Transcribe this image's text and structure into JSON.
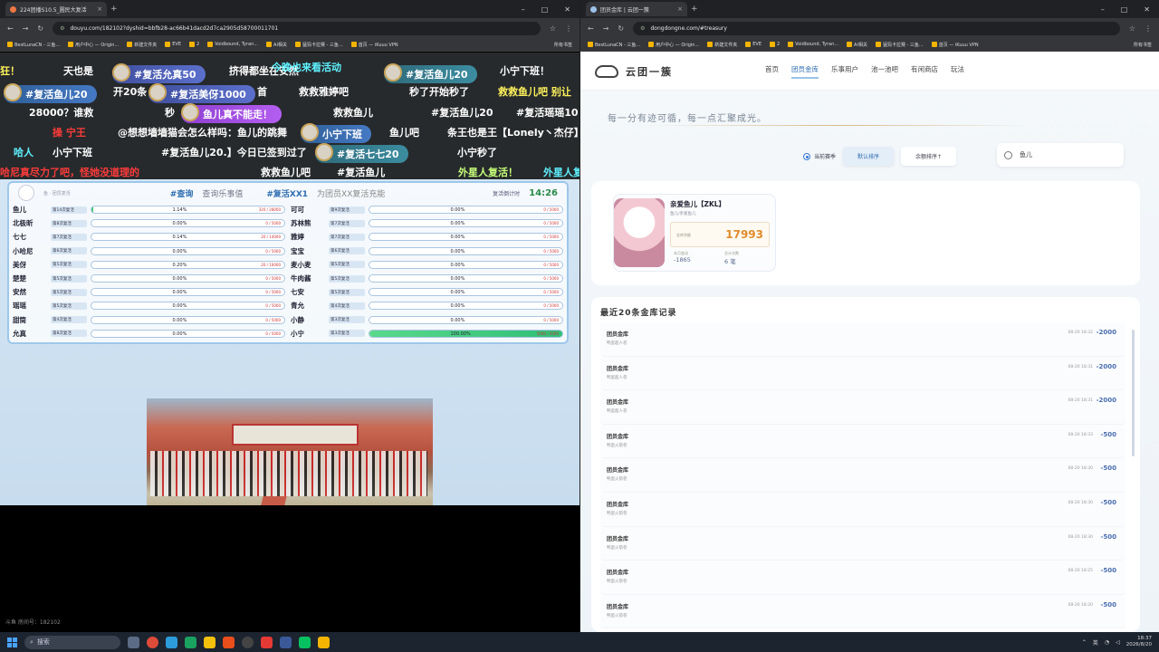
{
  "left_browser": {
    "tab_title": "224团播S10.5_圆民大复活",
    "url": "douyu.com/182102?dyshid=bbfb28-ac66b41dacd2d7ca2905d58700011701",
    "bookmarks": [
      "BestLunaCN - 三鱼...",
      "用户中心 — Origin...",
      "新建文件夹",
      "EVE",
      "2",
      "Voidbound, Tyran...",
      "AI相关",
      "猛犸卡拉赛 - 三鱼...",
      "首页 — iKuuu VPN"
    ],
    "bookmarks_more": "所有书签",
    "danmu": [
      {
        "t": "狂！",
        "c": "w"
      },
      {
        "t": "天也是",
        "c": "w"
      },
      {
        "t": "挤得都坐在安然",
        "c": "w"
      },
      {
        "t": "今晚也来看活动",
        "c": "c"
      },
      {
        "t": "小宁下班！",
        "c": "w"
      },
      {
        "t": "开20条",
        "c": "w"
      },
      {
        "t": "首",
        "c": "w"
      },
      {
        "t": "救救雅婷吧",
        "c": "w"
      },
      {
        "t": "秒了开始秒了",
        "c": "w"
      },
      {
        "t": "救救鱼儿吧 别让",
        "c": "y"
      },
      {
        "t": "28000？谁救",
        "c": "w"
      },
      {
        "t": "秒",
        "c": "w"
      },
      {
        "t": "救救鱼儿",
        "c": "w"
      },
      {
        "t": "#复活鱼儿20",
        "c": "w"
      },
      {
        "t": "#复活瑶瑶10",
        "c": "w"
      },
      {
        "t": "操 宁王",
        "c": "r"
      },
      {
        "t": "@想想墙墙猫会怎么样吗：鱼儿的跳舞",
        "c": "w"
      },
      {
        "t": "鱼儿吧",
        "c": "w"
      },
      {
        "t": "条王也是王【Lonely丶杰仔】",
        "c": "w"
      },
      {
        "t": "哈人",
        "c": "c"
      },
      {
        "t": "小宁下班",
        "c": "w"
      },
      {
        "t": "#复活鱼儿20.】今日已签到过了",
        "c": "w"
      },
      {
        "t": "#复活七七20",
        "c": "w"
      },
      {
        "t": "小宁秒了",
        "c": "w"
      },
      {
        "t": "哈尼真尽力了吧，怪她没道理的",
        "c": "r"
      },
      {
        "t": "救救鱼儿吧",
        "c": "w"
      },
      {
        "t": "#复活鱼儿",
        "c": "w"
      },
      {
        "t": "外星人复活！",
        "c": "g"
      },
      {
        "t": "外星人复",
        "c": "c"
      }
    ],
    "gift_badges": [
      "#复活允真50",
      "#复活鱼儿20",
      "#复活鱼儿20",
      "#复活美伢1000",
      "鱼儿真不能走！",
      "小宁下班",
      "#复活七七20"
    ],
    "panel": {
      "subtitle": "鱼 · 团员复活",
      "query_label": "#查询",
      "query_desc": "查询乐事值",
      "revive_label": "#复活XX1",
      "revive_desc": "为团员XX复活充能",
      "timer_label": "复活倒计时",
      "timer": "14:26",
      "left": [
        {
          "name": "鱼儿",
          "level": "第14次复活",
          "pct": "1.14%",
          "fill": 1.14,
          "count": "320 / 28000"
        },
        {
          "name": "北极昕",
          "level": "第8次复活",
          "pct": "0.00%",
          "fill": 0,
          "count": "0 / 5000"
        },
        {
          "name": "七七",
          "level": "第7次复活",
          "pct": "0.14%",
          "fill": 0.14,
          "count": "20 / 14000"
        },
        {
          "name": "小哈尼",
          "level": "第6次复活",
          "pct": "0.00%",
          "fill": 0,
          "count": "0 / 5000"
        },
        {
          "name": "美伢",
          "level": "第5次复活",
          "pct": "0.20%",
          "fill": 0.2,
          "count": "20 / 10000"
        },
        {
          "name": "楚楚",
          "level": "第5次复活",
          "pct": "0.00%",
          "fill": 0,
          "count": "0 / 5000"
        },
        {
          "name": "安然",
          "level": "第5次复活",
          "pct": "0.00%",
          "fill": 0,
          "count": "0 / 5000"
        },
        {
          "name": "瑶瑶",
          "level": "第5次复活",
          "pct": "0.00%",
          "fill": 0,
          "count": "0 / 5000"
        },
        {
          "name": "甜筒",
          "level": "第4次复活",
          "pct": "0.00%",
          "fill": 0,
          "count": "0 / 5000"
        },
        {
          "name": "允真",
          "level": "第8次复活",
          "pct": "0.00%",
          "fill": 0,
          "count": "0 / 5000"
        }
      ],
      "right": [
        {
          "name": "可可",
          "level": "第9次复活",
          "pct": "0.00%",
          "fill": 0,
          "count": "0 / 5000"
        },
        {
          "name": "苏林熊",
          "level": "第7次复活",
          "pct": "0.00%",
          "fill": 0,
          "count": "0 / 5000"
        },
        {
          "name": "雅婷",
          "level": "第7次复活",
          "pct": "0.00%",
          "fill": 0,
          "count": "0 / 5000"
        },
        {
          "name": "宝宝",
          "level": "第6次复活",
          "pct": "0.00%",
          "fill": 0,
          "count": "0 / 5000"
        },
        {
          "name": "麦小麦",
          "level": "第5次复活",
          "pct": "0.00%",
          "fill": 0,
          "count": "0 / 5000"
        },
        {
          "name": "牛肉酱",
          "level": "第5次复活",
          "pct": "0.00%",
          "fill": 0,
          "count": "0 / 5000"
        },
        {
          "name": "七安",
          "level": "第5次复活",
          "pct": "0.00%",
          "fill": 0,
          "count": "0 / 5000"
        },
        {
          "name": "青允",
          "level": "第4次复活",
          "pct": "0.00%",
          "fill": 0,
          "count": "0 / 5000"
        },
        {
          "name": "小静",
          "level": "第3次复活",
          "pct": "0.00%",
          "fill": 0,
          "count": "0 / 5000"
        },
        {
          "name": "小宁",
          "level": "第3次复活",
          "pct": "100.00%",
          "fill": 100,
          "count": "5000 / 5000"
        }
      ]
    },
    "room_no": "斗鱼 房间号：182102"
  },
  "right_browser": {
    "tab_title": "团员金库 | 云团一簇",
    "url": "dongdongne.com/#treasury",
    "bookmarks": [
      "BestLunaCN - 三鱼...",
      "用户中心 — Origin...",
      "新建文件夹",
      "EVE",
      "2",
      "Voidbound, Tyran...",
      "AI相关",
      "猛犸卡拉赛 - 三鱼...",
      "首页 — iKuuu VPN"
    ],
    "bookmarks_more": "所有书签",
    "brand": "云团一簇",
    "nav": [
      "首页",
      "团员金库",
      "乐事用户",
      "池一池吧",
      "有闲商店",
      "玩法"
    ],
    "slogan": "每一分有迹可循，每一点汇聚成光。",
    "filter_current": "当前赛季",
    "filter_sort1": "默认排序",
    "filter_sort2": "余额排序↑",
    "search_value": "鱼儿",
    "profile": {
      "name": "亲爱鱼儿【ZKL】",
      "group": "鱼儿/亲爱鱼儿",
      "balance_label": "金库余额",
      "balance": "17993",
      "stat1_label": "本月变动",
      "stat1": "-1865",
      "stat2_label": "总计次数",
      "stat2": "6 笔"
    },
    "records_title": "最近20条金库记录",
    "records": [
      {
        "t1": "团员金库",
        "t2": "鸭蛋超人卷",
        "date": "08-20 18:32",
        "amt": "-2000"
      },
      {
        "t1": "团员金库",
        "t2": "鸭蛋超人卷",
        "date": "08-20 18:31",
        "amt": "-2000"
      },
      {
        "t1": "团员金库",
        "t2": "鸭蛋超人卷",
        "date": "08-20 18:31",
        "amt": "-2000"
      },
      {
        "t1": "团员金库",
        "t2": "鸭蛋火箭卷",
        "date": "08-20 18:33",
        "amt": "-500"
      },
      {
        "t1": "团员金库",
        "t2": "鸭蛋火箭卷",
        "date": "08-20 18:30",
        "amt": "-500"
      },
      {
        "t1": "团员金库",
        "t2": "鸭蛋火箭卷",
        "date": "08-20 18:30",
        "amt": "-500"
      },
      {
        "t1": "团员金库",
        "t2": "鸭蛋火箭卷",
        "date": "08-20 18:30",
        "amt": "-500"
      },
      {
        "t1": "团员金库",
        "t2": "鸭蛋火箭卷",
        "date": "08-20 18:25",
        "amt": "-500"
      },
      {
        "t1": "团员金库",
        "t2": "鸭蛋火箭卷",
        "date": "08-20 18:20",
        "amt": "-500"
      }
    ]
  },
  "taskbar": {
    "search": "搜索",
    "ime": "英",
    "time": "18:37",
    "date": "2026/8/20"
  }
}
